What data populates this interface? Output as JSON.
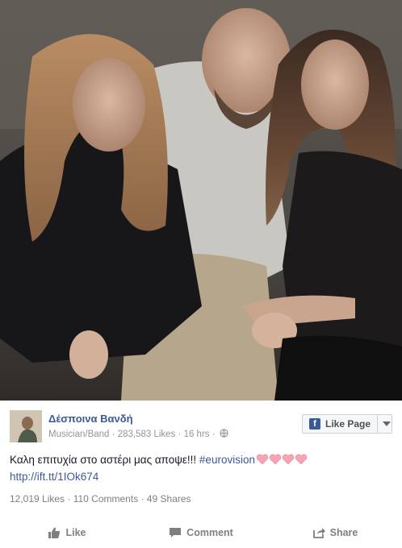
{
  "post": {
    "page_name": "Δέσποινα Βανδή",
    "category": "Musician/Band",
    "likes_count": "283,583 Likes",
    "time": "16 hrs",
    "separator": "·",
    "like_page_label": "Like Page",
    "text": "Καλη επιτυχία στο αστέρι μας αποψε!!! ",
    "hashtag": "#eurovision",
    "link": "http://ift.tt/1IOk674",
    "stats": "12,019 Likes · 110 Comments · 49 Shares"
  },
  "actions": {
    "like": "Like",
    "comment": "Comment",
    "share": "Share"
  },
  "colors": {
    "link_blue": "#3b5998",
    "meta_gray": "#90949c",
    "heart_pink": "#f4a6b4"
  },
  "icons": [
    "globe-icon",
    "facebook-icon",
    "chevron-down-icon",
    "heart-icon",
    "like-icon",
    "comment-icon",
    "share-icon"
  ]
}
